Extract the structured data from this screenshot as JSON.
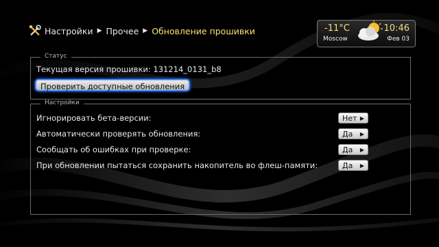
{
  "breadcrumb": {
    "items": [
      "Настройки",
      "Прочее"
    ],
    "current": "Обновление прошивки"
  },
  "weather": {
    "temperature": "-11°C",
    "city": "Moscow",
    "time": "10:46",
    "date": "Фев 03",
    "icon": "partly-cloudy-icon"
  },
  "status": {
    "legend": "Статус",
    "firmware_label": "Текущая версия прошивки: 131214_0131_b8",
    "check_button": "Проверить доступные обновления"
  },
  "settings": {
    "legend": "Настройки",
    "rows": [
      {
        "label": "Игнорировать бета-версии:",
        "value": "Нет"
      },
      {
        "label": "Автоматически проверять обновления:",
        "value": "Да"
      },
      {
        "label": "Сообщать об ошибках при проверке:",
        "value": "Да"
      },
      {
        "label": "При обновлении пытаться сохранить накопитель во флеш-памяти:",
        "value": "Да"
      }
    ]
  },
  "colors": {
    "accent_yellow": "#f5e27a",
    "focus_blue": "#3f8cff",
    "background": "#000000"
  }
}
